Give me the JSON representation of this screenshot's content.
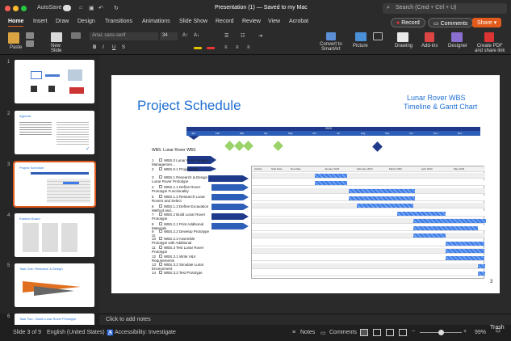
{
  "window": {
    "autosave": "AutoSave",
    "title": "Presentation (1) — Saved to my Mac",
    "search_placeholder": "Search (Cmd + Ctrl + U)"
  },
  "tabs": [
    "Home",
    "Insert",
    "Draw",
    "Design",
    "Transitions",
    "Animations",
    "Slide Show",
    "Record",
    "Review",
    "View",
    "Acrobat"
  ],
  "actions": {
    "record": "Record",
    "comments": "Comments",
    "share": "Share"
  },
  "ribbon": {
    "paste": "Paste",
    "new_slide": "New\nSlide",
    "font": "Arial, sans-serif",
    "size": "34",
    "convert": "Convert to\nSmartArt",
    "picture": "Picture",
    "drawing": "Drawing",
    "addins": "Add-ins",
    "designer": "Designer",
    "pdf": "Create PDF\nand share link"
  },
  "slides": [
    {
      "num": "1"
    },
    {
      "num": "2",
      "title": "Agenda"
    },
    {
      "num": "3",
      "title": "Project Schedule"
    },
    {
      "num": "4",
      "title": "Kanban Board"
    },
    {
      "num": "5",
      "title": "Task One: Research & Design"
    },
    {
      "num": "6",
      "title": "Task Two - Build Lunar Rover Prototype"
    }
  ],
  "slide": {
    "title": "Project Schedule",
    "subtitle_line1": "Lunar Rover WBS",
    "subtitle_line2": "Timeline & Gantt Chart",
    "page_num": "3",
    "timeline_year": "2023",
    "months": [
      "Jan",
      "Feb",
      "Mar",
      "Apr",
      "May",
      "Jun",
      "Jul",
      "Aug",
      "Sep",
      "Oct",
      "Nov",
      "Dec"
    ],
    "wbs_root": "WBS. Lunar Rover WBS",
    "wbs_rows": [
      {
        "n": "1",
        "t": "WBS.0 Lunar Rover Project Managemen..."
      },
      {
        "n": "2",
        "t": "WBS.0.1 Project Plan"
      },
      {
        "n": "3",
        "t": "WBS.1 Research & Design Lunar Rover Prototype"
      },
      {
        "n": "4",
        "t": "WBS.1.1 Define Rover Prototype Functionality"
      },
      {
        "n": "5",
        "t": "WBS.1.2 Research Lunar Rovers and Select"
      },
      {
        "n": "6",
        "t": "WBS.1.3 Define Excavation Method and..."
      },
      {
        "n": "7",
        "t": "WBS.2 Build Lunar Rover Prototype"
      },
      {
        "n": "8",
        "t": "WBS.2.1 Print Additional Materials"
      },
      {
        "n": "9",
        "t": "WBS.2.2 Develop Prototype UI"
      },
      {
        "n": "10",
        "t": "WBS.2.3 Assemble Prototype with Additional"
      },
      {
        "n": "11",
        "t": "WBS.3 Test Lunar Rover Prototype"
      },
      {
        "n": "12",
        "t": "WBS.3.1 Write V&V Requirements"
      },
      {
        "n": "13",
        "t": "WBS.3.2 Simulate Lunar Environment"
      },
      {
        "n": "14",
        "t": "WBS.3.3 Test Prototype"
      }
    ],
    "gantt_headers": {
      "activity": "Activity",
      "start": "Start Date",
      "due": "Due Date",
      "months": [
        "January 2023",
        "February 2023",
        "March 2023",
        "April 2023",
        "May 2023"
      ]
    }
  },
  "notes_placeholder": "Click to add notes",
  "status": {
    "slide": "Slide 3 of 9",
    "lang": "English (United States)",
    "access": "Accessibility: Investigate",
    "notes": "Notes",
    "comments": "Comments",
    "zoom": "99%"
  },
  "trash": "Trash"
}
